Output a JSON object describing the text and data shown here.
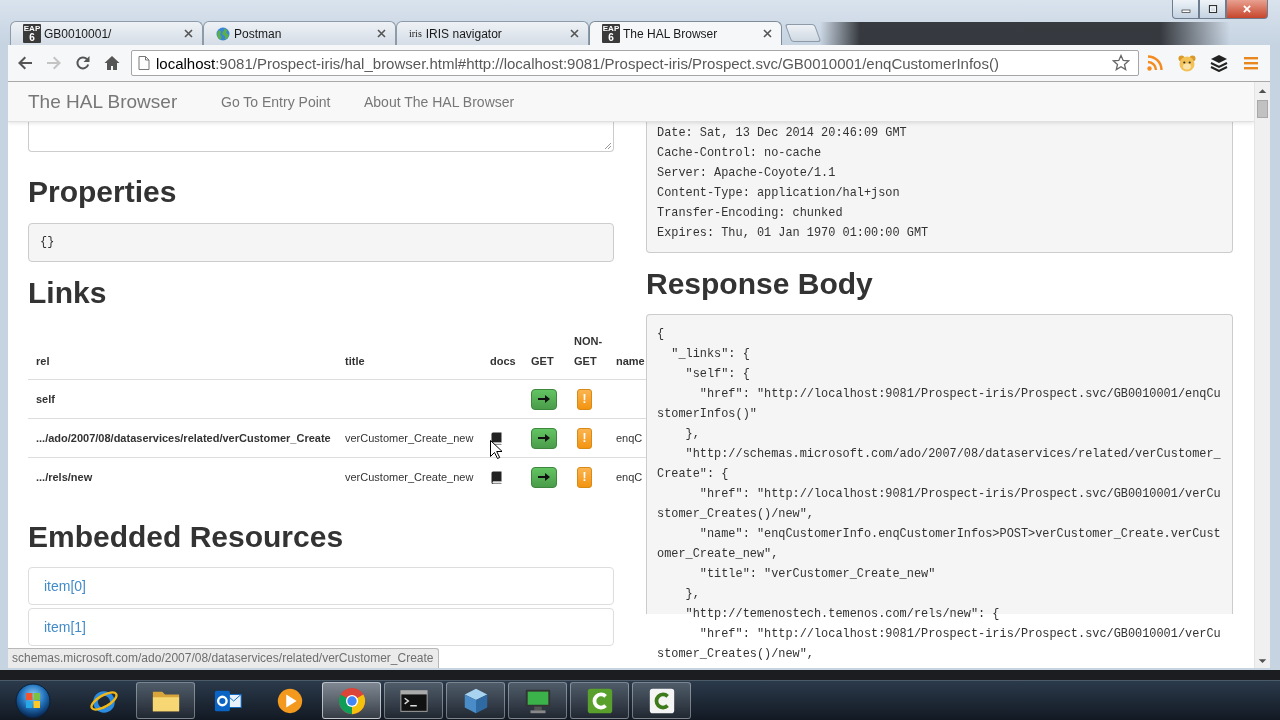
{
  "browser": {
    "tabs": [
      {
        "title": "GB0010001/",
        "favicon": {
          "kind": "tile",
          "lines": [
            "EAP",
            "6"
          ]
        },
        "selected": false
      },
      {
        "title": "Postman",
        "favicon": {
          "kind": "globe"
        },
        "selected": false
      },
      {
        "title": "IRIS navigator",
        "favicon": {
          "kind": "text",
          "text": "iris"
        },
        "selected": false
      },
      {
        "title": "The HAL Browser",
        "favicon": {
          "kind": "tile",
          "lines": [
            "EAP",
            "6"
          ]
        },
        "selected": true
      }
    ],
    "toolbar": {
      "forward_disabled": true,
      "address": {
        "host": "localhost",
        "rest": ":9081/Prospect-iris/hal_browser.html#http://localhost:9081/Prospect-iris/Prospect.svc/GB0010001/enqCustomerInfos()"
      }
    }
  },
  "page": {
    "navbar": {
      "brand": "The HAL Browser",
      "links": [
        "Go To Entry Point",
        "About The HAL Browser"
      ]
    },
    "properties": {
      "heading": "Properties",
      "body": "{}"
    },
    "links": {
      "heading": "Links",
      "columns": [
        "rel",
        "title",
        "docs",
        "GET",
        "NON-GET",
        "name"
      ],
      "rows": [
        {
          "rel": "self",
          "docs": false,
          "non_get": "!"
        },
        {
          "rel": ".../ado/2007/08/dataservices/related/verCustomer_Create",
          "title": "verCustomer_Create_new",
          "docs": true,
          "non_get": "!",
          "name": "enqC"
        },
        {
          "rel": ".../rels/new",
          "title": "verCustomer_Create_new",
          "docs": true,
          "non_get": "!",
          "name": "enqC"
        }
      ]
    },
    "embedded": {
      "heading": "Embedded Resources",
      "items": [
        "item[0]",
        "item[1]"
      ]
    },
    "response_headers": {
      "lines": [
        "Date: Sat, 13 Dec 2014 20:46:09 GMT",
        "Cache-Control: no-cache",
        "Server: Apache-Coyote/1.1",
        "Content-Type: application/hal+json",
        "Transfer-Encoding: chunked",
        "Expires: Thu, 01 Jan 1970 01:00:00 GMT"
      ]
    },
    "response_body": {
      "heading": "Response Body",
      "lines": [
        "{",
        "  \"_links\": {",
        "    \"self\": {",
        "      \"href\": \"http://localhost:9081/Prospect-iris/Prospect.svc/GB0010001/enqCu",
        "stomerInfos()\"",
        "    },",
        "    \"http://schemas.microsoft.com/ado/2007/08/dataservices/related/verCustomer_",
        "Create\": {",
        "      \"href\": \"http://localhost:9081/Prospect-iris/Prospect.svc/GB0010001/verCu",
        "stomer_Creates()/new\",",
        "      \"name\": \"enqCustomerInfo.enqCustomerInfos>POST>verCustomer_Create.verCust",
        "omer_Create_new\",",
        "      \"title\": \"verCustomer_Create_new\"",
        "    },",
        "    \"http://temenostech.temenos.com/rels/new\": {",
        "      \"href\": \"http://localhost:9081/Prospect-iris/Prospect.svc/GB0010001/verCu",
        "stomer_Creates()/new\","
      ]
    }
  },
  "status_bubble": "schemas.microsoft.com/ado/2007/08/dataservices/related/verCustomer_Create",
  "taskbar": {
    "items": [
      {
        "kind": "ring",
        "running": false,
        "active": false
      },
      {
        "kind": "folder",
        "running": true,
        "active": false
      },
      {
        "kind": "mail",
        "running": false,
        "active": false
      },
      {
        "kind": "media",
        "running": false,
        "active": false
      },
      {
        "kind": "wheel",
        "running": true,
        "active": true
      },
      {
        "kind": "terminal",
        "running": true,
        "active": false
      },
      {
        "kind": "cube",
        "running": true,
        "active": false
      },
      {
        "kind": "monitor",
        "running": true,
        "active": false
      },
      {
        "kind": "arc_dark",
        "running": true,
        "active": false
      },
      {
        "kind": "arc_light",
        "running": true,
        "active": false
      }
    ]
  }
}
